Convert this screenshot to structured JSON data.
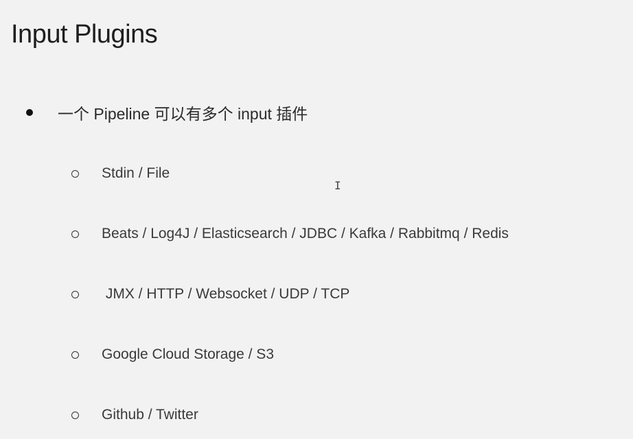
{
  "slide": {
    "title": "Input Plugins",
    "bullet": "一个 Pipeline 可以有多个 input 插件",
    "sub_items": [
      "Stdin / File",
      "Beats / Log4J / Elasticsearch / JDBC / Kafka / Rabbitmq / Redis",
      " JMX / HTTP / Websocket / UDP / TCP",
      "Google Cloud Storage / S3",
      "Github / Twitter"
    ]
  },
  "icons": {
    "bullet": "filled-circle-icon",
    "sub_bullet": "hollow-circle-icon",
    "cursor": "text-cursor-icon"
  },
  "colors": {
    "background": "#f2f2f2",
    "text": "#2a2a2a"
  }
}
